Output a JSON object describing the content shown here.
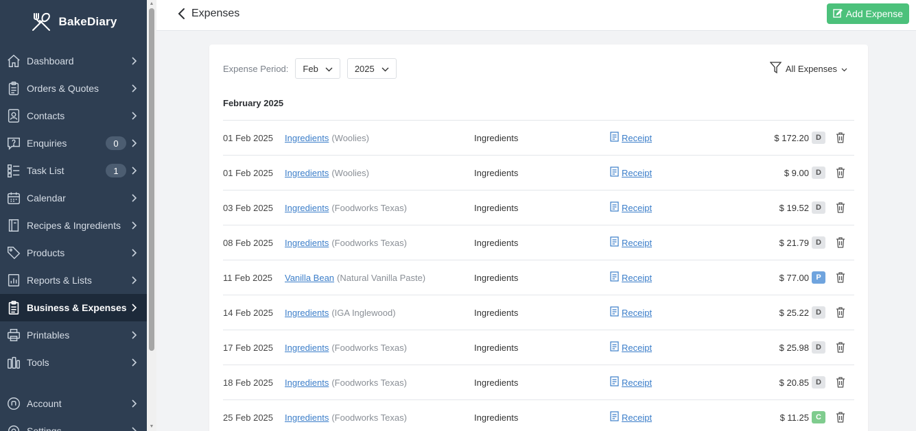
{
  "app": {
    "name": "BakeDiary"
  },
  "sidebar": {
    "items": [
      {
        "label": "Dashboard",
        "icon": "home-icon"
      },
      {
        "label": "Orders & Quotes",
        "icon": "clipboard-icon"
      },
      {
        "label": "Contacts",
        "icon": "contacts-icon"
      },
      {
        "label": "Enquiries",
        "icon": "question-icon",
        "count": "0"
      },
      {
        "label": "Task List",
        "icon": "checklist-icon",
        "count": "1"
      },
      {
        "label": "Calendar",
        "icon": "calendar-icon"
      },
      {
        "label": "Recipes & Ingredients",
        "icon": "book-icon"
      },
      {
        "label": "Products",
        "icon": "tag-icon"
      },
      {
        "label": "Reports & Lists",
        "icon": "report-icon"
      },
      {
        "label": "Business & Expenses",
        "icon": "receipt-icon",
        "active": true
      },
      {
        "label": "Printables",
        "icon": "printer-icon"
      },
      {
        "label": "Tools",
        "icon": "tools-icon"
      }
    ],
    "bottom_items": [
      {
        "label": "Account",
        "icon": "account-icon"
      },
      {
        "label": "Settings",
        "icon": "settings-icon"
      }
    ]
  },
  "header": {
    "title": "Expenses",
    "add_label": "Add Expense"
  },
  "filters": {
    "period_label": "Expense Period:",
    "month": "Feb",
    "year": "2025",
    "type": "All Expenses"
  },
  "month_heading": "February 2025",
  "expenses": [
    {
      "date": "01 Feb 2025",
      "item": "Ingredients",
      "vendor": "(Woolies)",
      "category": "Ingredients",
      "receipt": "Receipt",
      "amount": "$ 172.20",
      "badge": "D"
    },
    {
      "date": "01 Feb 2025",
      "item": "Ingredients",
      "vendor": "(Woolies)",
      "category": "Ingredients",
      "receipt": "Receipt",
      "amount": "$ 9.00",
      "badge": "D"
    },
    {
      "date": "03 Feb 2025",
      "item": "Ingredients",
      "vendor": "(Foodworks Texas)",
      "category": "Ingredients",
      "receipt": "Receipt",
      "amount": "$ 19.52",
      "badge": "D"
    },
    {
      "date": "08 Feb 2025",
      "item": "Ingredients",
      "vendor": "(Foodworks Texas)",
      "category": "Ingredients",
      "receipt": "Receipt",
      "amount": "$ 21.79",
      "badge": "D"
    },
    {
      "date": "11 Feb 2025",
      "item": "Vanilla Bean",
      "vendor": "(Natural Vanilla Paste)",
      "category": "Ingredients",
      "receipt": "Receipt",
      "amount": "$ 77.00",
      "badge": "P"
    },
    {
      "date": "14 Feb 2025",
      "item": "Ingredients",
      "vendor": "(IGA Inglewood)",
      "category": "Ingredients",
      "receipt": "Receipt",
      "amount": "$ 25.22",
      "badge": "D"
    },
    {
      "date": "17 Feb 2025",
      "item": "Ingredients",
      "vendor": "(Foodworks Texas)",
      "category": "Ingredients",
      "receipt": "Receipt",
      "amount": "$ 25.98",
      "badge": "D"
    },
    {
      "date": "18 Feb 2025",
      "item": "Ingredients",
      "vendor": "(Foodworks Texas)",
      "category": "Ingredients",
      "receipt": "Receipt",
      "amount": "$ 20.85",
      "badge": "D"
    },
    {
      "date": "25 Feb 2025",
      "item": "Ingredients",
      "vendor": "(Foodworks Texas)",
      "category": "Ingredients",
      "receipt": "Receipt",
      "amount": "$ 11.25",
      "badge": "C"
    }
  ]
}
